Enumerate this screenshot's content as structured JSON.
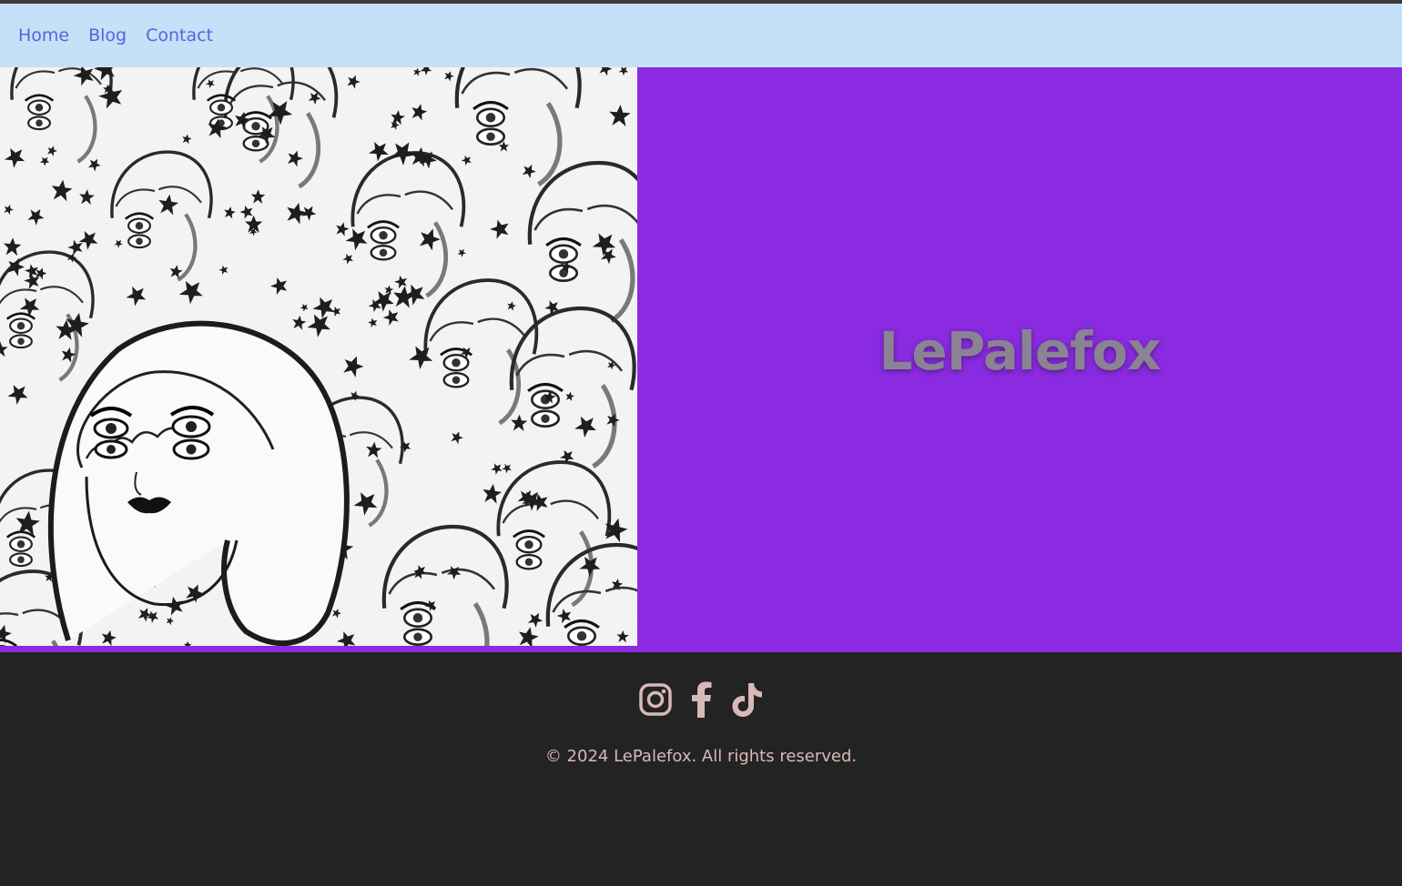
{
  "nav": {
    "items": [
      {
        "label": "Home"
      },
      {
        "label": "Blog"
      },
      {
        "label": "Contact"
      }
    ]
  },
  "hero": {
    "title": "LePalefox",
    "background_color": "#8a2be2",
    "image_subject": "black-and-white ink illustration of girl faces with stars"
  },
  "footer": {
    "social_icons": [
      "instagram-icon",
      "facebook-icon",
      "tiktok-icon"
    ],
    "copyright": "© 2024 LePalefox. All rights reserved.",
    "icon_color": "#d9b8b8"
  },
  "colors": {
    "nav_bg": "#c5e0f7",
    "nav_link": "#5b61e0",
    "footer_bg": "#232323"
  }
}
